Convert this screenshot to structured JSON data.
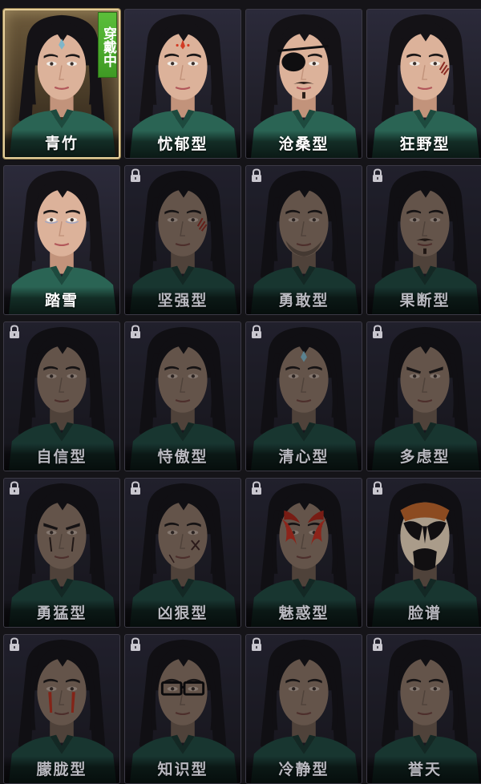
{
  "wearing_badge": "穿戴中",
  "colors": {
    "selected_border": "#e6cf9a",
    "badge_green": "#4aa82c",
    "tile_bg": "#25242f",
    "label_text": "#ffffff"
  },
  "faces": [
    {
      "label": "青竹",
      "locked": false,
      "selected": true,
      "style": "forehead-jewel"
    },
    {
      "label": "忧郁型",
      "locked": false,
      "selected": false,
      "style": "red-forehead-mark"
    },
    {
      "label": "沧桑型",
      "locked": false,
      "selected": false,
      "style": "eyepatch-mustache"
    },
    {
      "label": "狂野型",
      "locked": false,
      "selected": false,
      "style": "cheek-scar"
    },
    {
      "label": "踏雪",
      "locked": false,
      "selected": false,
      "style": "pale-eyeliner"
    },
    {
      "label": "坚强型",
      "locked": true,
      "selected": false,
      "style": "cheek-scar"
    },
    {
      "label": "勇敢型",
      "locked": true,
      "selected": false,
      "style": "stubble"
    },
    {
      "label": "果断型",
      "locked": true,
      "selected": false,
      "style": "mustache"
    },
    {
      "label": "自信型",
      "locked": true,
      "selected": false,
      "style": "plain"
    },
    {
      "label": "恃傲型",
      "locked": true,
      "selected": false,
      "style": "plain"
    },
    {
      "label": "清心型",
      "locked": true,
      "selected": false,
      "style": "forehead-jewel"
    },
    {
      "label": "多虑型",
      "locked": true,
      "selected": false,
      "style": "furrowed-brow"
    },
    {
      "label": "勇猛型",
      "locked": true,
      "selected": false,
      "style": "war-paint-dark"
    },
    {
      "label": "凶狠型",
      "locked": true,
      "selected": false,
      "style": "cross-scar"
    },
    {
      "label": "魅惑型",
      "locked": true,
      "selected": false,
      "style": "red-flame-paint"
    },
    {
      "label": "脸谱",
      "locked": true,
      "selected": false,
      "style": "opera-mask"
    },
    {
      "label": "朦胧型",
      "locked": true,
      "selected": false,
      "style": "red-tear-paint"
    },
    {
      "label": "知识型",
      "locked": true,
      "selected": false,
      "style": "glasses"
    },
    {
      "label": "冷静型",
      "locked": true,
      "selected": false,
      "style": "plain"
    },
    {
      "label": "誉天",
      "locked": true,
      "selected": false,
      "style": "plain"
    }
  ]
}
